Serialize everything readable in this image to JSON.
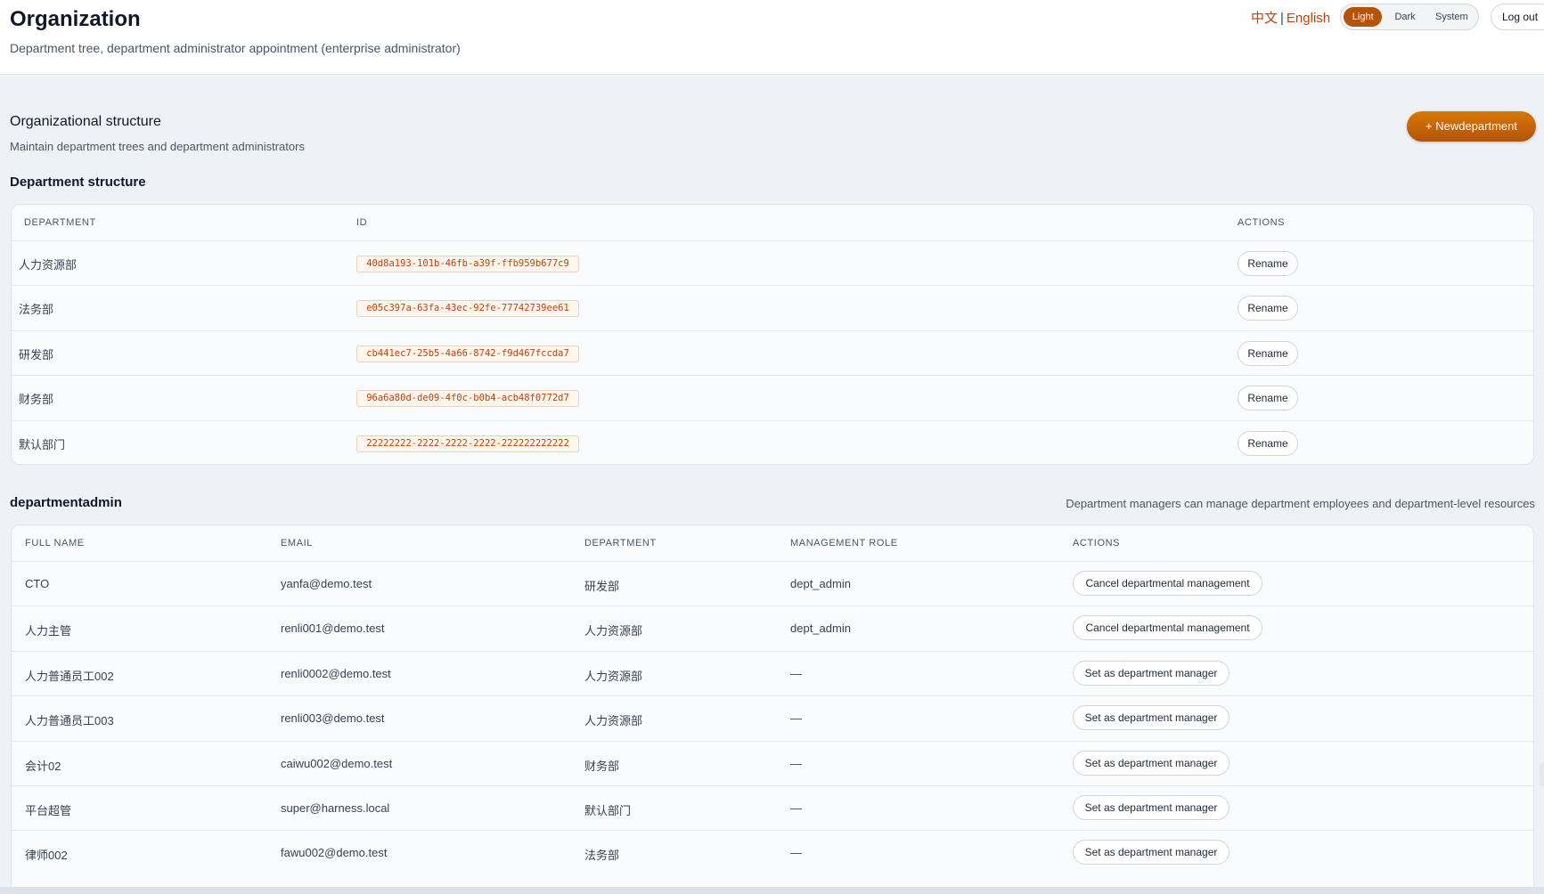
{
  "header": {
    "title": "Organization",
    "subtitle": "Department tree, department administrator appointment (enterprise administrator)",
    "lang_zh": "中文",
    "lang_sep": "|",
    "lang_en": "English",
    "theme": {
      "light": "Light",
      "dark": "Dark",
      "system": "System",
      "active": "Light"
    },
    "logout": "Log out"
  },
  "org_section": {
    "title": "Organizational structure",
    "subtitle": "Maintain department trees and department administrators",
    "new_button": "+ Newdepartment"
  },
  "dept_table": {
    "heading": "Department structure",
    "columns": [
      "DEPARTMENT",
      "ID",
      "ACTIONS"
    ],
    "rows": [
      {
        "name": "人力资源部",
        "id": "40d8a193-101b-46fb-a39f-ffb959b677c9",
        "action": "Rename"
      },
      {
        "name": "法务部",
        "id": "e05c397a-63fa-43ec-92fe-77742739ee61",
        "action": "Rename"
      },
      {
        "name": "研发部",
        "id": "cb441ec7-25b5-4a66-8742-f9d467fccda7",
        "action": "Rename"
      },
      {
        "name": "财务部",
        "id": "96a6a80d-de09-4f0c-b0b4-acb48f0772d7",
        "action": "Rename"
      },
      {
        "name": "默认部门",
        "id": "22222222-2222-2222-2222-222222222222",
        "action": "Rename"
      }
    ]
  },
  "admin_table": {
    "heading": "departmentadmin",
    "note": "Department managers can manage department employees and department-level resources",
    "columns": [
      "FULL NAME",
      "EMAIL",
      "DEPARTMENT",
      "MANAGEMENT ROLE",
      "ACTIONS"
    ],
    "rows": [
      {
        "name": "CTO",
        "email": "yanfa@demo.test",
        "dept": "研发部",
        "role": "dept_admin",
        "action": "Cancel departmental management"
      },
      {
        "name": "人力主管",
        "email": "renli001@demo.test",
        "dept": "人力资源部",
        "role": "dept_admin",
        "action": "Cancel departmental management"
      },
      {
        "name": "人力普通员工002",
        "email": "renli0002@demo.test",
        "dept": "人力资源部",
        "role": "—",
        "action": "Set as department manager"
      },
      {
        "name": "人力普通员工003",
        "email": "renli003@demo.test",
        "dept": "人力资源部",
        "role": "—",
        "action": "Set as department manager"
      },
      {
        "name": "会计02",
        "email": "caiwu002@demo.test",
        "dept": "财务部",
        "role": "—",
        "action": "Set as department manager"
      },
      {
        "name": "平台超管",
        "email": "super@harness.local",
        "dept": "默认部门",
        "role": "—",
        "action": "Set as department manager"
      },
      {
        "name": "律师002",
        "email": "fawu002@demo.test",
        "dept": "法务部",
        "role": "—",
        "action": "Set as department manager"
      }
    ]
  },
  "colors": {
    "accent": "#b45309",
    "accent_text": "#c2410c",
    "background": "#eef2f6"
  }
}
